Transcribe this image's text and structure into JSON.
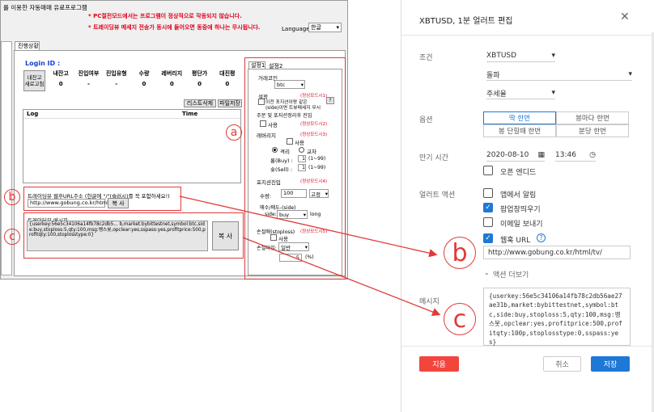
{
  "left_app": {
    "title": "를 이용한 자동매매 유료프로그램",
    "notice1": "* PC절전모드에서는 프로그램이 정상적으로 작동되지 않습니다.",
    "notice2": "* 트레이딩뷰 메세지 전송가 동시에 들어오면 동중에 하나는 무시됩니다.",
    "language_label": "Language:",
    "language_value": "한글",
    "tab_main": "진행상황",
    "login_label": "Login ID :",
    "refresh_button": "내잔고 새로고침",
    "stats": [
      {
        "h": "내잔고",
        "v": "0"
      },
      {
        "h": "진입여부",
        "v": "-"
      },
      {
        "h": "진입유형",
        "v": "-"
      },
      {
        "h": "수량",
        "v": "0"
      },
      {
        "h": "레버리지",
        "v": "0"
      },
      {
        "h": "평단가",
        "v": "0"
      },
      {
        "h": "대진평",
        "v": "0"
      }
    ],
    "list_delete_button": "리스트삭제",
    "save_file_button": "파일저장",
    "log_header": "Log",
    "time_header": "Time",
    "webhook_label": "트레이딩뷰 웹후URL주소 (헌글에 \"/\"(슬러시)를 꼭 포함하세요!)",
    "webhook_url": "http://www.gobung.co.kr/html/tv/",
    "copy_button_small": "복 사",
    "tv_message_label": "트레이딩뷰 메시지",
    "tv_message": "{userkey:56e5c34106a14fb78c2db5... b,market:bybittestnet,symbol:btc,side:buy,stoploss:5,qty:100,msg:펭스봇,opclear:yes,sspass:yes,profitprice:500,profitqty:100,stoplosstype:0}",
    "copy_button_big": "복 사",
    "settings": {
      "tab1": "설정1",
      "tab2": "설정2",
      "coin_label": "거래코인",
      "coin_value": "btc",
      "setting_label": "설정",
      "setting_status": "(정상모드시1)",
      "setting_text1": "이전 포지션이랑 같은",
      "setting_text2": "(side)이면 트뷰메세지 무시",
      "opclear_label": "주문 및 포지션정리후 진입",
      "use_text": "사용",
      "use_status": "(정상모드시2)",
      "leverage_label": "레버리지",
      "leverage_status": "(정상모드시3)",
      "cross": "격리",
      "isolated": "교차",
      "buy_label": "롱(Buy) :",
      "buy_value": "1",
      "range": "(1~99)",
      "sell_label": "숏(Sell) :",
      "sell_value": "1",
      "entry_label": "포지션진입",
      "entry_status": "(정상모드시4)",
      "qty_label": "수량:",
      "qty_value": "100",
      "qty_mode": "고정",
      "side_label": "매수/매도-(side)",
      "side_sub": "side:",
      "side_value": "buy",
      "side_value2": "long",
      "stop_label": "손절매(stoploss)",
      "stop_status": "(정상모드시5)",
      "stop_type_label": "손절타입:",
      "stop_type_value": "일반",
      "stop_value": "5",
      "percent": "(%)"
    }
  },
  "annotations": {
    "a": "a",
    "b": "b",
    "c": "c"
  },
  "dialog": {
    "title": "XBTUSD, 1분 얼러트 편집",
    "cond_label": "조건",
    "cond_symbol": "XBTUSD",
    "cond_op": "돌파",
    "cond_target": "주세율",
    "option_label": "옵션",
    "opt1": "딱 한번",
    "opt2": "봉마다 한번",
    "opt3": "봉 단힐때 한번",
    "opt4": "분당 한번",
    "expiry_label": "만기 시간",
    "expiry_date": "2020-08-10",
    "expiry_time": "13:46",
    "open_ended": "오픈 엔디드",
    "action_label": "얼러트 액션",
    "act1": "앱에서 알림",
    "act2": "팝업창띄우기",
    "act3": "이메일 보내기",
    "act4": "웹훅 URL",
    "webhook_value": "http://www.gobung.co.kr/html/tv/",
    "more_actions": "액션 더보기",
    "message_label": "메시지",
    "message": "{userkey:56e5c34106a14fb78c2db56ae27ae31b,market:bybittestnet,symbol:btc,side:buy,stoploss:5,qty:100,msg:펭스봇,opclear:yes,profitprice:500,profitqty:100p,stoplosstype:0,sspass:yes}",
    "remove_button": "지움",
    "cancel_button": "취소",
    "save_button": "저장",
    "colors": {
      "accent": "#1e78d7",
      "danger": "#f2453d"
    }
  }
}
